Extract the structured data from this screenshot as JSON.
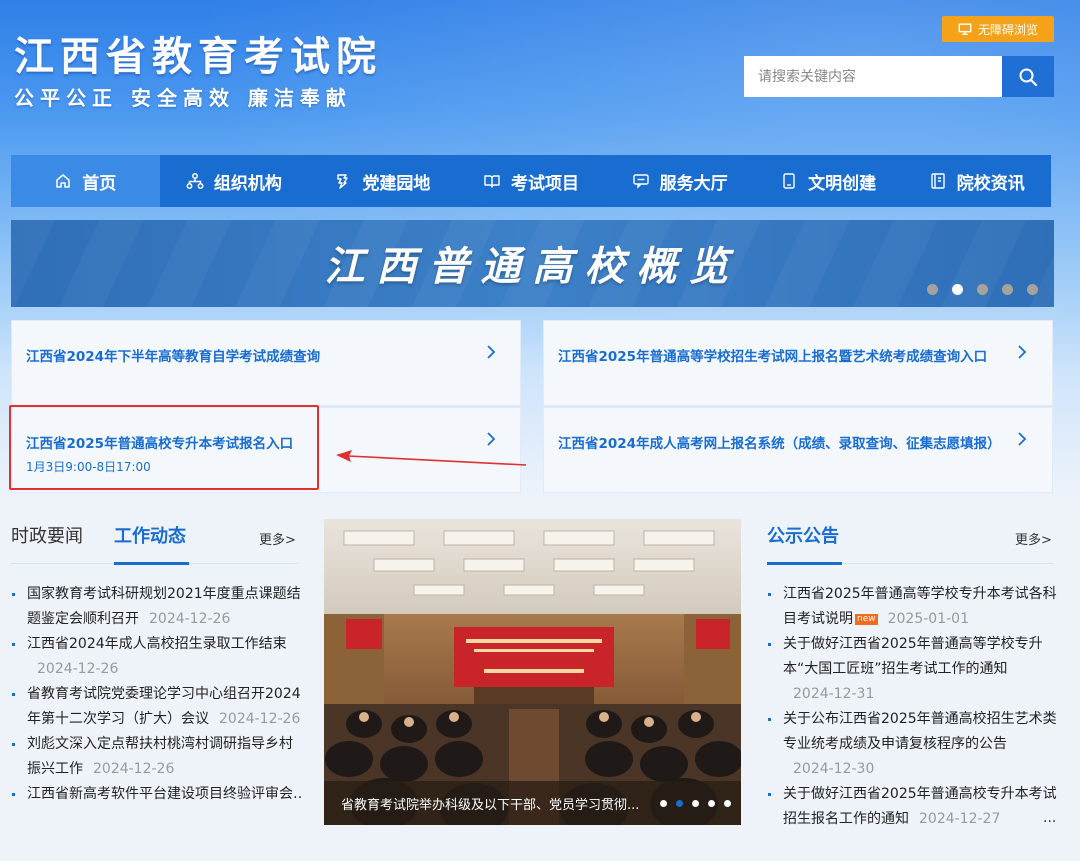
{
  "header": {
    "title": "江西省教育考试院",
    "slogan": "公平公正  安全高效  廉洁奉献",
    "accessibility_label": "无障碍浏览",
    "search_placeholder": "请搜索关键内容"
  },
  "nav": {
    "items": [
      {
        "label": "首页",
        "icon": "home-icon"
      },
      {
        "label": "组织机构",
        "icon": "org-chart-icon"
      },
      {
        "label": "党建园地",
        "icon": "party-building-icon"
      },
      {
        "label": "考试项目",
        "icon": "book-icon"
      },
      {
        "label": "服务大厅",
        "icon": "chat-service-icon"
      },
      {
        "label": "文明创建",
        "icon": "tablet-icon"
      },
      {
        "label": "院校资讯",
        "icon": "document-icon"
      }
    ]
  },
  "banner": {
    "text": "江西普通高校概览",
    "dot_count": 5,
    "active_dot": 1
  },
  "quick_links": [
    {
      "title": "江西省2024年下半年高等教育自学考试成绩查询",
      "sub": ""
    },
    {
      "title": "江西省2025年普通高等学校招生考试网上报名暨艺术统考成绩查询入口",
      "sub": ""
    },
    {
      "title": "江西省2025年普通高校专升本考试报名入口",
      "sub": "1月3日9:00-8日17:00"
    },
    {
      "title": "江西省2024年成人高考网上报名系统（成绩、录取查询、征集志愿填报）",
      "sub": ""
    }
  ],
  "news_left": {
    "tab_inactive": "时政要闻",
    "tab_active": "工作动态",
    "more": "更多>",
    "items": [
      {
        "title": "国家教育考试科研规划2021年度重点课题结题鉴定会顺利召开",
        "date": "2024-12-26"
      },
      {
        "title": "江西省2024年成人高校招生录取工作结束",
        "date": "2024-12-26"
      },
      {
        "title": "省教育考试院党委理论学习中心组召开2024年第十二次学习（扩大）会议",
        "date": "2024-12-26"
      },
      {
        "title": "刘彪文深入定点帮扶村桃湾村调研指导乡村振兴工作",
        "date": "2024-12-26"
      },
      {
        "title": "江西省新高考软件平台建设项目终验评审会…",
        "date": ""
      }
    ]
  },
  "photo": {
    "caption": "省教育考试院举办科级及以下干部、党员学习贯彻...",
    "dot_count": 5,
    "active_dot": 1
  },
  "news_right": {
    "tab_active": "公示公告",
    "more": "更多>",
    "hot_label": "new",
    "items": [
      {
        "title": "江西省2025年普通高等学校专升本考试各科目考试说明",
        "date": "2025-01-01",
        "hot": true
      },
      {
        "title": "关于做好江西省2025年普通高等学校专升本“大国工匠班”招生考试工作的通知",
        "date": "2024-12-31",
        "hot": false
      },
      {
        "title": "关于公布江西省2025年普通高校招生艺术类专业统考成绩及申请复核程序的公告",
        "date": "2024-12-30",
        "hot": false
      },
      {
        "title": "关于做好江西省2025年普通高校专升本考试招生报名工作的通知",
        "date": "2024-12-27",
        "hot": false
      }
    ],
    "ellipsis": "..."
  },
  "colors": {
    "primary": "#1a6dd0",
    "nav_active": "#3a8ae6",
    "accent_orange": "#f5a21b",
    "highlight_red": "#e03030"
  }
}
